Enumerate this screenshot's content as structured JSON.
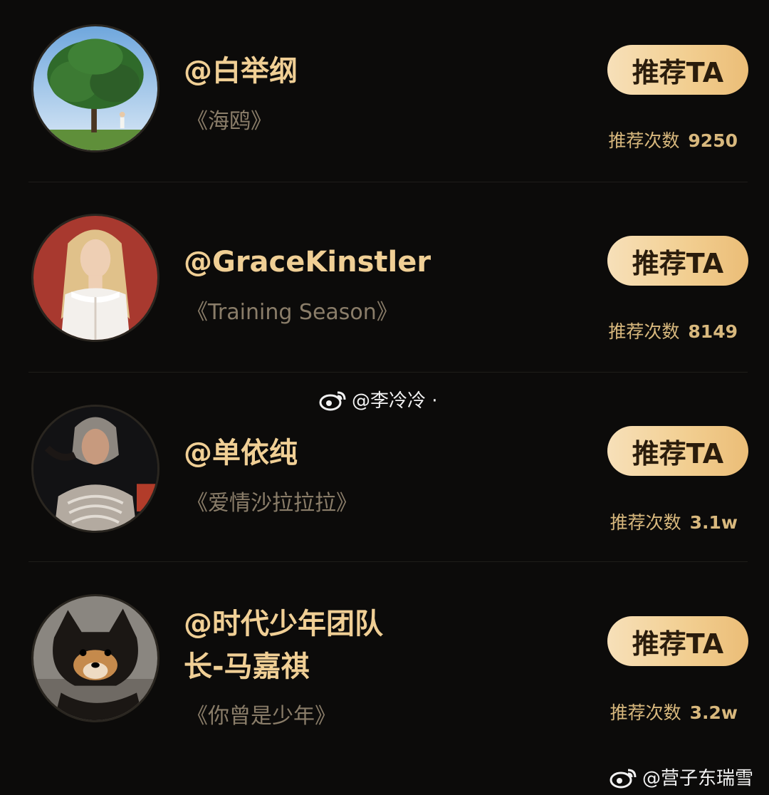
{
  "recommend_list": [
    {
      "handle": "@白举纲",
      "song": "《海鸥》",
      "button_label": "推荐TA",
      "count_label": "推荐次数",
      "count_value": "9250",
      "avatar_icon": "tree-landscape-avatar"
    },
    {
      "handle": "@GraceKinstler",
      "song": "《Training Season》",
      "button_label": "推荐TA",
      "count_label": "推荐次数",
      "count_value": "8149",
      "avatar_icon": "blonde-woman-avatar"
    },
    {
      "handle": "@单依纯",
      "song": "《爱情沙拉拉拉》",
      "button_label": "推荐TA",
      "count_label": "推荐次数",
      "count_value": "3.1w",
      "avatar_icon": "woman-chain-headpiece-avatar"
    },
    {
      "handle_line1": "@时代少年团队",
      "handle_line2": "长-马嘉祺",
      "song": "《你曾是少年》",
      "button_label": "推荐TA",
      "count_label": "推荐次数",
      "count_value": "3.2w",
      "avatar_icon": "shiba-dog-avatar"
    }
  ],
  "watermarks": {
    "center": "@李冷冷 ·",
    "bottom_right": "@营子东瑞雪"
  },
  "colors": {
    "background": "#0c0b0a",
    "name_gold": "#f0cf95",
    "song_gray": "#8a7d69",
    "button_gradient_start": "#f7e0b9",
    "button_gradient_end": "#ebbd77",
    "button_text": "#2a1c0c"
  }
}
